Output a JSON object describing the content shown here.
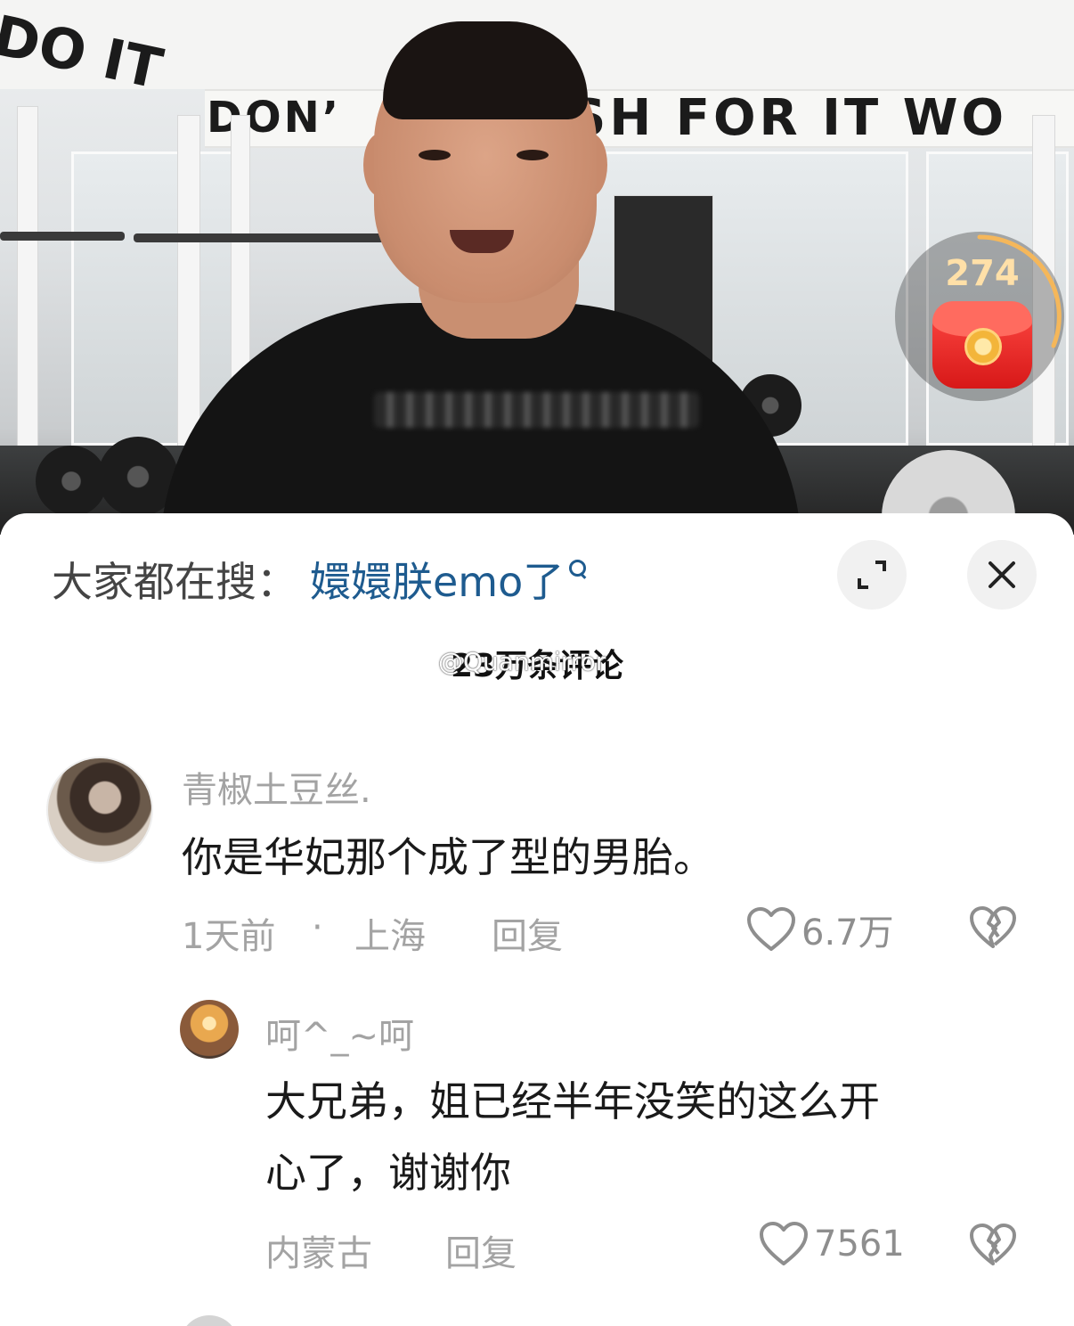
{
  "video": {
    "banner_text": "SH FOR IT WO",
    "banner_left_text": "DON’",
    "corner_text": "DO IT",
    "red_packet_count": "274"
  },
  "search_bar": {
    "prefix": "大家都在搜：",
    "term": "嬛嬛朕emo了"
  },
  "comments_header": {
    "count_label": "23万条评论",
    "watermark": "@Quanmirror"
  },
  "comments": [
    {
      "username": "青椒土豆丝.",
      "text": "你是华妃那个成了型的男胎。",
      "time": "1天前",
      "location": "上海",
      "reply_label": "回复",
      "likes": "6.7万"
    },
    {
      "username": "呵^_~呵",
      "text_line1": "大兄弟，姐已经半年没笑的这么开",
      "text_line2": "心了，谢谢你",
      "location": "内蒙古",
      "reply_label": "回复",
      "likes": "7561"
    }
  ],
  "icons": {
    "expand": "expand-icon",
    "close": "close-icon",
    "like": "heart-icon",
    "dislike": "broken-heart-icon",
    "search": "search-icon"
  },
  "colors": {
    "search_term": "#1e5b8f",
    "red_packet": "#e32222",
    "ring": "#f5b75a",
    "muted_text": "#a3a3a3"
  }
}
